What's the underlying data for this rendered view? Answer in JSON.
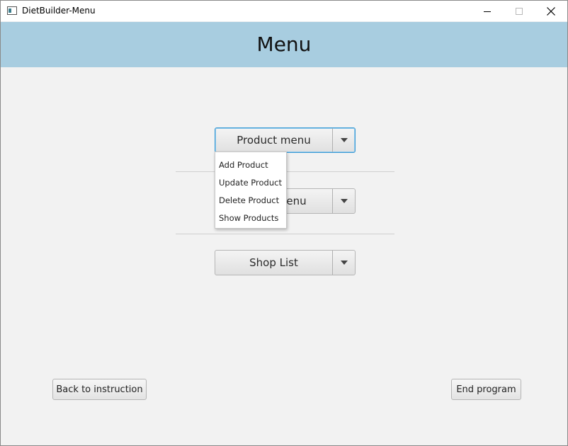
{
  "window": {
    "title": "DietBuilder-Menu",
    "icons": {
      "app": "app-window-icon",
      "minimize": "minimize-icon",
      "maximize": "maximize-icon",
      "close": "close-icon"
    }
  },
  "header": {
    "title": "Menu",
    "background_color": "#a8cde0"
  },
  "menus": {
    "product": {
      "label": "Product menu",
      "expanded": true,
      "items": [
        "Add Product",
        "Update Product",
        "Delete Product",
        "Show Products"
      ]
    },
    "diet": {
      "visible_label_fragment": "enu"
    },
    "shop": {
      "label": "Shop List"
    }
  },
  "footer": {
    "back_label": "Back to instruction",
    "end_label": "End program"
  },
  "colors": {
    "focus_border": "#3a9bd5",
    "background": "#f2f2f2"
  }
}
